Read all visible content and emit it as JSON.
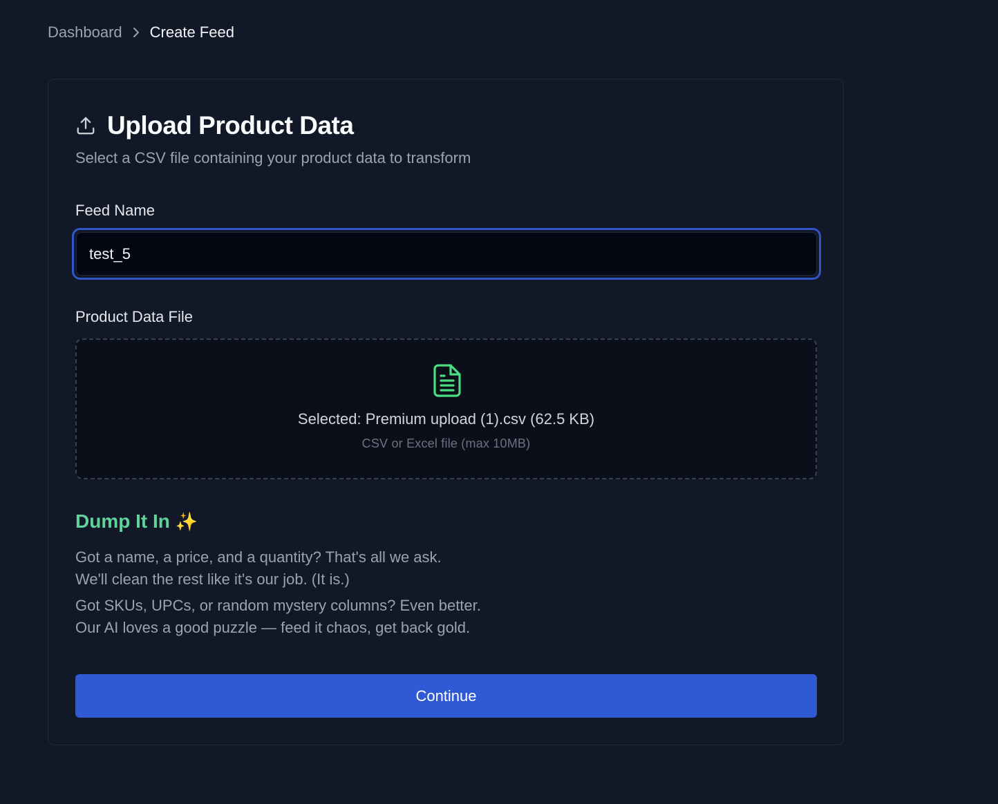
{
  "breadcrumb": {
    "parent": "Dashboard",
    "current": "Create Feed"
  },
  "card": {
    "title": "Upload Product Data",
    "subtitle": "Select a CSV file containing your product data to transform",
    "feed_name_label": "Feed Name",
    "feed_name_value": "test_5",
    "file_label": "Product Data File",
    "selected_file": "Selected: Premium upload (1).csv (62.5 KB)",
    "file_hint": "CSV or Excel file (max 10MB)",
    "dump_title": "Dump It In",
    "dump_emoji": "✨",
    "para1_line1": "Got a name, a price, and a quantity? That's all we ask.",
    "para1_line2": "We'll clean the rest like it's our job. (It is.)",
    "para2_line1": "Got SKUs, UPCs, or random mystery columns? Even better.",
    "para2_line2": "Our AI loves a good puzzle — feed it chaos, get back gold.",
    "continue_label": "Continue"
  },
  "icons": {
    "upload": "upload-icon",
    "file": "file-text-icon",
    "chevron": "chevron-right-icon"
  },
  "colors": {
    "background": "#111827",
    "accent": "#3059d6",
    "focus_ring": "#2f55c9",
    "success": "#5fd39a"
  }
}
